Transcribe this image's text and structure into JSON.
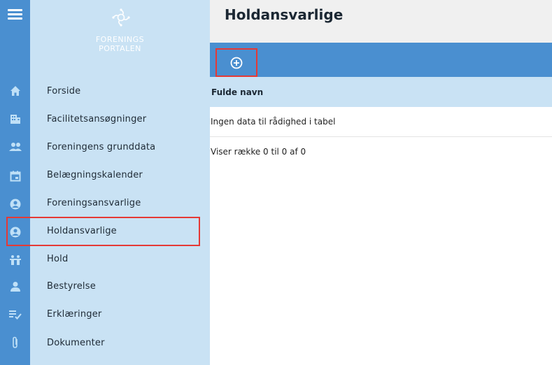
{
  "logo": {
    "line1": "FORENINGS",
    "line2": "PORTALEN"
  },
  "page": {
    "title": "Holdansvarlige"
  },
  "nav": {
    "items": [
      {
        "label": "Forside",
        "icon": "home-icon"
      },
      {
        "label": "Facilitetsansøgninger",
        "icon": "building-icon"
      },
      {
        "label": "Foreningens grunddata",
        "icon": "people-icon"
      },
      {
        "label": "Belægningskalender",
        "icon": "calendar-icon"
      },
      {
        "label": "Foreningsansvarlige",
        "icon": "user-circle-icon"
      },
      {
        "label": "Holdansvarlige",
        "icon": "user-circle-icon",
        "selected": true
      },
      {
        "label": "Hold",
        "icon": "team-icon"
      },
      {
        "label": "Bestyrelse",
        "icon": "board-member-icon"
      },
      {
        "label": "Erklæringer",
        "icon": "checklist-icon"
      },
      {
        "label": "Dokumenter",
        "icon": "paperclip-icon"
      }
    ]
  },
  "toolbar": {
    "add_icon": "plus-circle-icon"
  },
  "table": {
    "columns": [
      "Fulde navn"
    ],
    "empty_text": "Ingen data til rådighed i tabel",
    "info_text": "Viser række 0 til 0 af 0"
  },
  "colors": {
    "accent": "#4a8fd0",
    "sidebar": "#c9e2f4",
    "highlight": "#e53935",
    "header_bg": "#f0f0f0"
  }
}
